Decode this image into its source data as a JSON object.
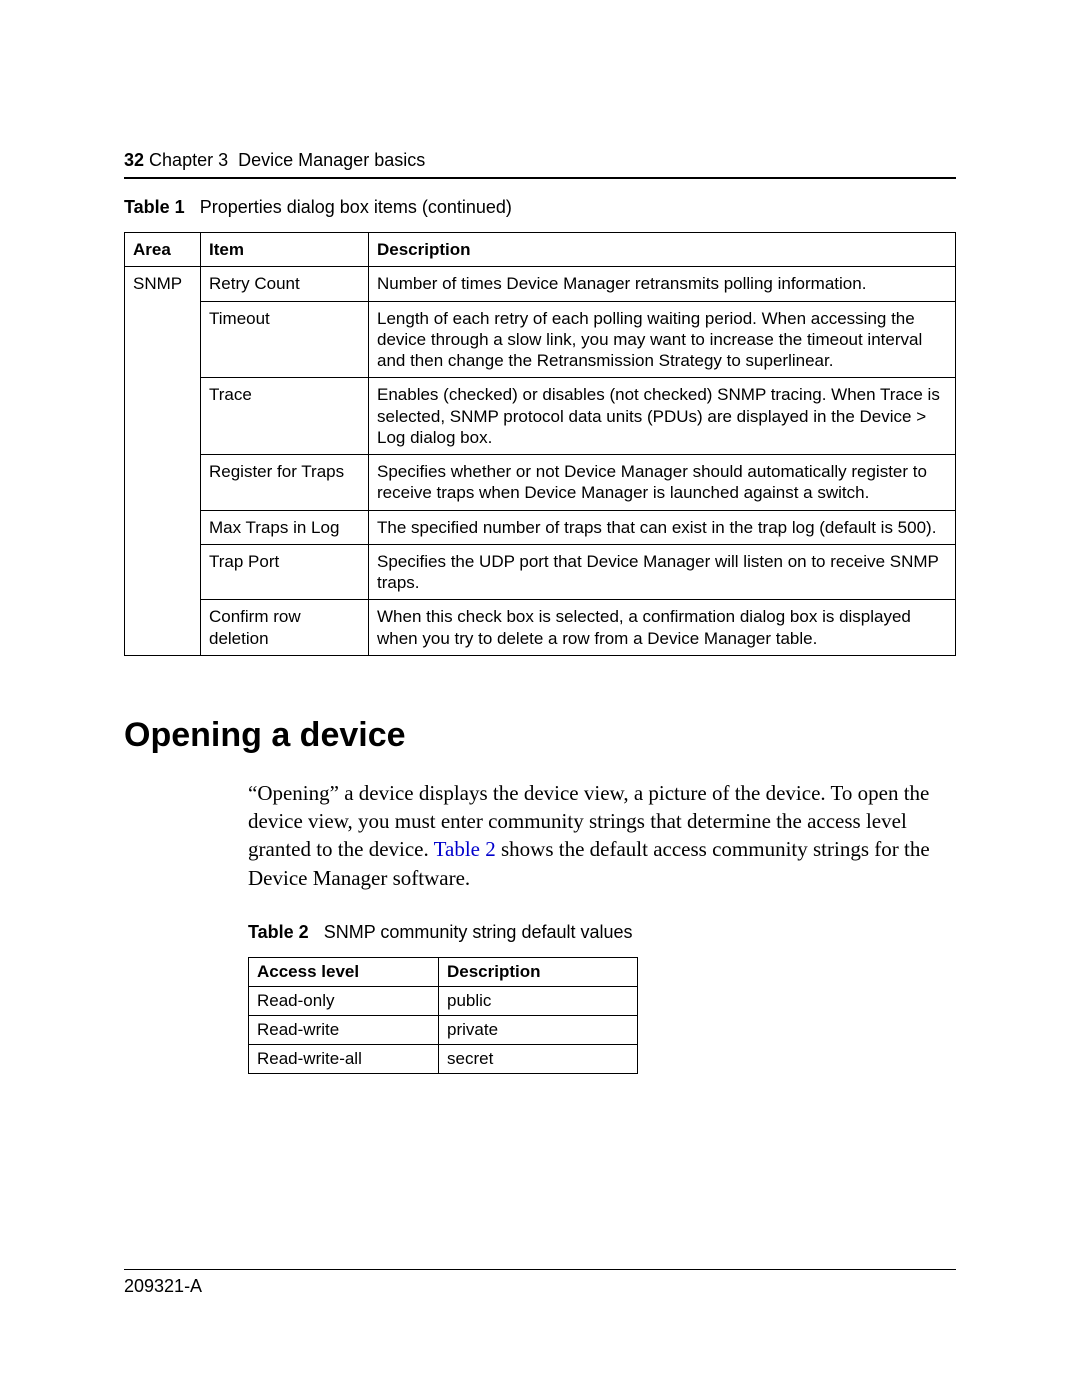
{
  "header": {
    "page_number": "32",
    "chapter_label": "Chapter 3",
    "chapter_title": "Device Manager basics"
  },
  "table1": {
    "label": "Table 1",
    "title": "Properties dialog box items (continued)",
    "columns": [
      "Area",
      "Item",
      "Description"
    ],
    "area": "SNMP",
    "rows": [
      {
        "item": "Retry Count",
        "desc": "Number of times Device Manager retransmits polling information."
      },
      {
        "item": "Timeout",
        "desc": "Length of each retry of each polling waiting period. When accessing the device through a slow link, you may want to increase the timeout interval and then change the Retransmission Strategy to superlinear."
      },
      {
        "item": "Trace",
        "desc": "Enables (checked) or disables (not checked) SNMP tracing. When Trace is selected, SNMP protocol data units (PDUs) are displayed in the Device > Log dialog box."
      },
      {
        "item": "Register for Traps",
        "desc": "Specifies whether or not Device Manager should automatically register to receive traps when Device Manager is launched against a switch."
      },
      {
        "item": "Max Traps in Log",
        "desc": "The specified number of traps that can exist in the trap log (default is 500)."
      },
      {
        "item": "Trap Port",
        "desc": "Specifies the UDP port that Device Manager will listen on to receive SNMP traps."
      },
      {
        "item": "Confirm row deletion",
        "desc": "When this check box is selected, a confirmation dialog box is displayed when you try to delete a row from a Device Manager table."
      }
    ]
  },
  "section": {
    "heading": "Opening a device",
    "para_before_link": "“Opening” a device displays the device view, a picture of the device. To open the device view, you must enter community strings that determine the access level granted to the device. ",
    "link_text": "Table 2",
    "para_after_link": " shows the default access community strings for the Device Manager software."
  },
  "table2": {
    "label": "Table 2",
    "title": "SNMP community string default values",
    "columns": [
      "Access level",
      "Description"
    ],
    "rows": [
      {
        "access": "Read-only",
        "desc": "public"
      },
      {
        "access": "Read-write",
        "desc": "private"
      },
      {
        "access": "Read-write-all",
        "desc": "secret"
      }
    ]
  },
  "footer": {
    "doc_number": "209321-A"
  }
}
